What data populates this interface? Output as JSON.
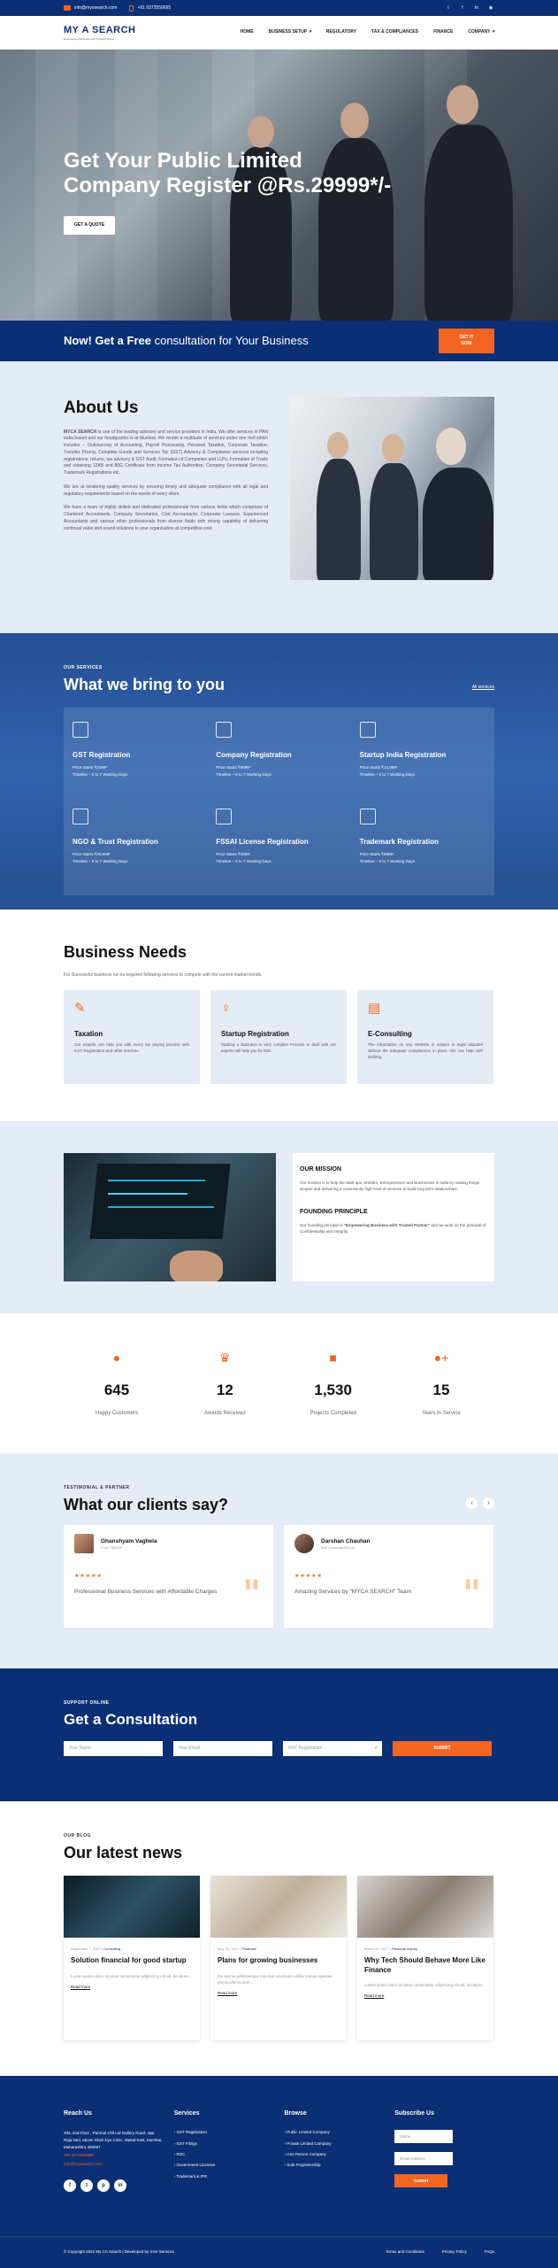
{
  "topbar": {
    "email": "info@myosearch.com",
    "phone": "+91 9372550695",
    "social": [
      "twitter-icon",
      "facebook-icon",
      "linkedin-icon",
      "rss-icon"
    ]
  },
  "nav": {
    "logo_main": "MY A SEARCH",
    "logo_tagline": "Empowering Business with Trusted Partner",
    "items": [
      {
        "label": "HOME",
        "dropdown": false
      },
      {
        "label": "BUSINESS SETUP",
        "dropdown": true
      },
      {
        "label": "REGULATORY",
        "dropdown": false
      },
      {
        "label": "TAX & COMPLIANCES",
        "dropdown": false
      },
      {
        "label": "FINANCE",
        "dropdown": false
      },
      {
        "label": "COMPANY",
        "dropdown": true
      }
    ]
  },
  "hero": {
    "line1": "Get Your Public Limited",
    "line2": "Company Register @Rs.29999*/-",
    "button": "GET A QUOTE"
  },
  "strip": {
    "bold": "Now! Get a Free",
    "rest": "consultation for Your Business",
    "button": "GET IT NOW"
  },
  "about": {
    "title": "About Us",
    "p1_brand": "MYCA SEARCH",
    "p1": " is one of the leading advisory and service providers in India. We offer services in PAN India based and our headquarter is at Mumbai. We render a multitude of services under one roof which includes – Outsourcing of Accounting, Payroll Processing, Personal Taxation, Corporate Taxation, Transfer Pricing, Complete Goods and Services Tax (GST) Advisory & Compliance services including registrations, returns, tax advisory & GST Audit, Formation of Companies and LLPs, Formation of Trusts and obtaining 12AB and 80G Certificate from Income Tax Authorities, Company Secretarial Services, Trademark Registrations etc.",
    "p2": "We are at rendering quality services by ensuring timely and adequate compliance with all legal and regulatory requirements based on the needs of every client.",
    "p3": "We have a team of highly skilled and dedicated professionals from various fields which comprises of Chartered Accountants, Company Secretaries, Cost Accountants, Corporate Lawyers, Experienced Accountants and various other professionals from diverse fields with strong capability of delivering continual value and sound solutions to your organisation at competitive cost."
  },
  "services": {
    "eyebrow": "OUR SERVICES",
    "title": "What we bring to you",
    "all_link": "All services",
    "items": [
      {
        "icon": "ledger-icon",
        "title": "GST Registration",
        "price": "Price Starts ₹2499*",
        "timeline": "Timeline – 5 to 7 Working Days"
      },
      {
        "icon": "document-icon",
        "title": "Company Registration",
        "price": "Price Starts ₹6999*",
        "timeline": "Timeline – 5 to 7 Working Days"
      },
      {
        "icon": "bar-chart-icon",
        "title": "Startup India Registration",
        "price": "Price Starts ₹14,999*",
        "timeline": "Timeline – 5 to 7 Working Days"
      },
      {
        "icon": "calendar-icon",
        "title": "NGO & Trust Registration",
        "price": "Price Starts ₹25,999*",
        "timeline": "Timeline – 5 to 7 Working Days"
      },
      {
        "icon": "license-icon",
        "title": "FSSAI License Registration",
        "price": "Price Starts ₹5999*",
        "timeline": "Timeline – 5 to 7 Working Days"
      },
      {
        "icon": "trademark-icon",
        "title": "Trademark Registration",
        "price": "Price Starts ₹5999*",
        "timeline": "Timeline – 5 to 7 Working Days"
      }
    ]
  },
  "needs": {
    "title": "Business Needs",
    "subtitle": "For Successful business run its required following services to compete with the current market trends.",
    "items": [
      {
        "icon": "pen-icon",
        "title": "Taxation",
        "text": "Our experts can help you with every tax paying process with GST Registration and other services."
      },
      {
        "icon": "lightbulb-icon",
        "title": "Startup Registration",
        "text": "Starting a Business is very complex Process to deal with our experts will help you for that."
      },
      {
        "icon": "document-icon",
        "title": "E-Consulting",
        "text": "The information on any Website is subject to legal disputes without the adequate compliances in place. We can help with drafting."
      }
    ]
  },
  "mission": {
    "mission_title": "OUR MISSION",
    "mission_text": "Our mission is to help the Start ups, MSMEs, Entrepreneurs and Businesses in India by making things simpler and delivering a consistently high level of services to build long term relationships.",
    "principle_title": "FOUNDING PRINCIPLE",
    "principle_lead": "Our founding principle is ",
    "principle_bold": "\"Empowering Business with Trusted Partner\"",
    "principle_tail": " and we work on the principal of Confidentiality and Integrity."
  },
  "stats": [
    {
      "icon": "user-icon",
      "value": "645",
      "label": "Happy Customers"
    },
    {
      "icon": "trophy-icon",
      "value": "12",
      "label": "Awards Received"
    },
    {
      "icon": "file-icon",
      "value": "1,530",
      "label": "Projects Completed"
    },
    {
      "icon": "user-plus-icon",
      "value": "15",
      "label": "Years In Service"
    }
  ],
  "testimonials": {
    "eyebrow": "TESTIMONIAL & PARTNER",
    "title": "What our clients say?",
    "items": [
      {
        "name": "Ghanshyam Vaghela",
        "role": "From TBCEIP",
        "stars": 5,
        "quote": "Professional Business Services with Affordable Charges"
      },
      {
        "name": "Darshan Chauhan",
        "role": "Bolt Concepts Pvt Ltd",
        "stars": 5,
        "quote": "Amazing Services by \"MYCA SEARCH\" Team"
      }
    ]
  },
  "consult": {
    "eyebrow": "SUPPORT ONLINE",
    "title": "Get a Consultation",
    "name_ph": "Your Name",
    "email_ph": "Your Email",
    "select_val": "GST Registration",
    "button": "SUBMIT"
  },
  "blog": {
    "eyebrow": "OUR BLOG",
    "title": "Our latest news",
    "posts": [
      {
        "date": "September 7, 2017",
        "cat": "Consulting",
        "title": "Solution financial for good startup",
        "excerpt": "Lorem ipsum dolor sit amet consectetur adipiscing elit ad, tincidunt...",
        "more": "Read more"
      },
      {
        "date": "May 22, 2017",
        "cat": "Financial",
        "title": "Plans for growing businesses",
        "excerpt": "Ibe lacinia pellentesque interdum tincidunt cubilia massa egestas primis ullamcorper...",
        "more": "Read more"
      },
      {
        "date": "March 12, 2017",
        "cat": "Personal Inquiry",
        "title": "Why Tech Should Behave More Like Finance",
        "excerpt": "Lorem ipsum dolor sit amet consectetur adipiscing elit ad, tincidunt...",
        "more": "Read more"
      }
    ]
  },
  "footer": {
    "reach_title": "Reach Us",
    "address": "203, 2nd Floor , Panmal Chil Ltd Gallery Road, opp. Raja Ned, above Shah Eye Clinic, Malad East, Mumbai, Maharashtra 400097",
    "phone": "+91 9372550695",
    "email": "info@myosearch.com",
    "services_title": "Services",
    "services": [
      "GST Registration",
      "GST Filings",
      "ROC",
      "Government Licenses",
      "Trademark & IPR"
    ],
    "browse_title": "Browse",
    "browse": [
      "Public Limited Company",
      "Private Limited Company",
      "One Person Company",
      "Sole Proprietorship"
    ],
    "subscribe_title": "Subscribe Us",
    "sub_name_ph": "Name",
    "sub_email_ph": "Email Address",
    "sub_button": "SUBMIT",
    "social": [
      "f",
      "t",
      "p",
      "in"
    ],
    "copyright": "© Copyright 2021 My CA Search | Developed by Il-ter Services",
    "links": [
      "Terms and Conditions",
      "Privacy Policy",
      "FAQs"
    ]
  }
}
